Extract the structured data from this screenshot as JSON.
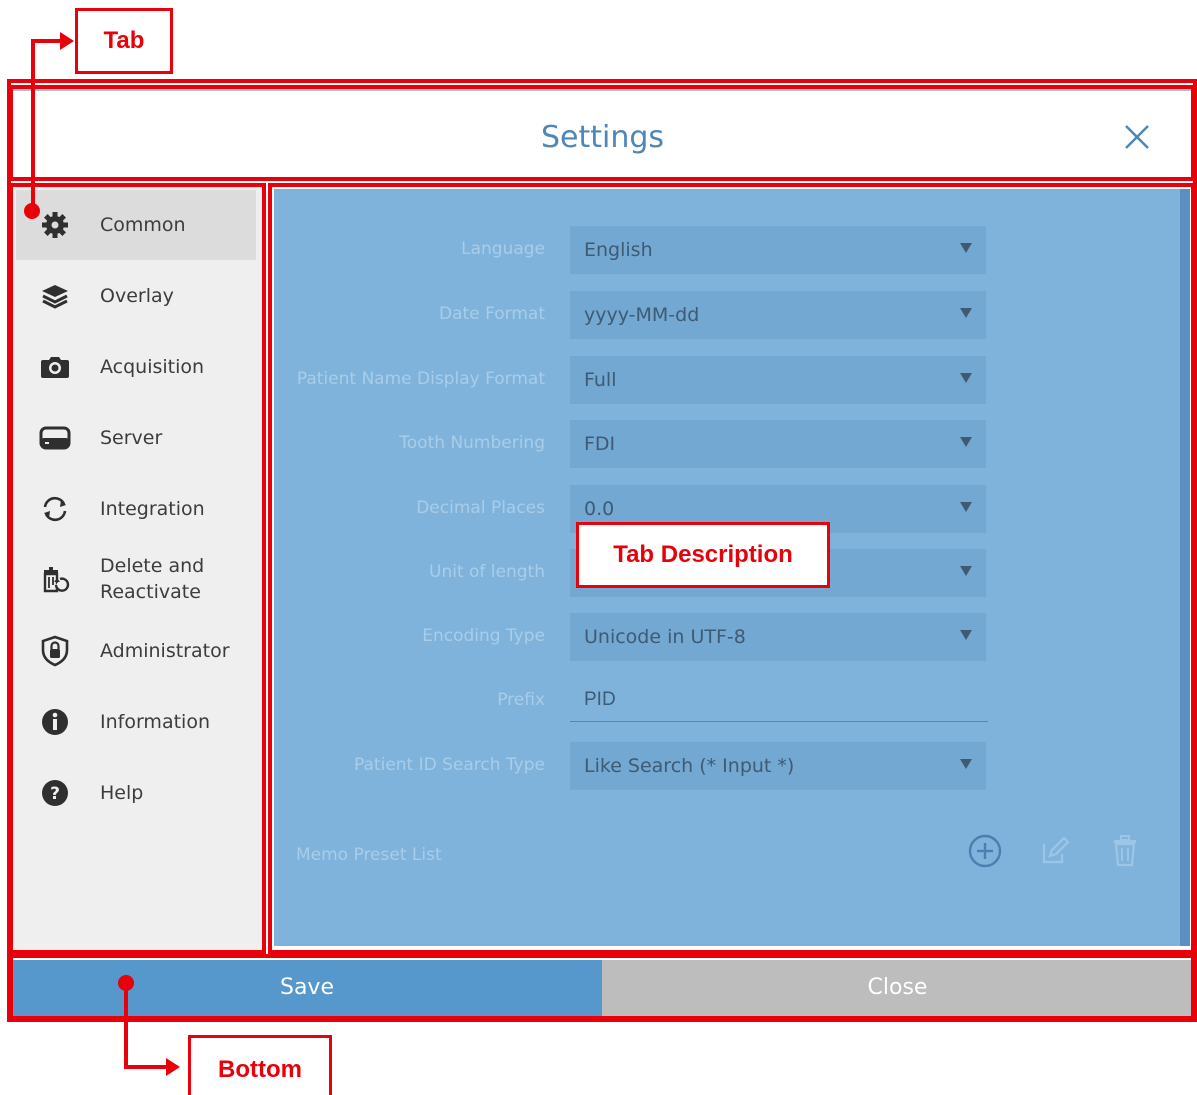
{
  "dialog": {
    "title": "Settings"
  },
  "sidebar": {
    "items": [
      {
        "label": "Common",
        "icon": "gear-icon",
        "active": true
      },
      {
        "label": "Overlay",
        "icon": "layers-icon"
      },
      {
        "label": "Acquisition",
        "icon": "camera-icon"
      },
      {
        "label": "Server",
        "icon": "server-icon"
      },
      {
        "label": "Integration",
        "icon": "sync-icon"
      },
      {
        "label": "Delete and\nReactivate",
        "icon": "trash-restore-icon"
      },
      {
        "label": "Administrator",
        "icon": "shield-lock-icon"
      },
      {
        "label": "Information",
        "icon": "info-icon"
      },
      {
        "label": "Help",
        "icon": "help-icon"
      }
    ]
  },
  "form": {
    "language": {
      "label": "Language",
      "value": "English"
    },
    "date_format": {
      "label": "Date Format",
      "value": "yyyy-MM-dd"
    },
    "patient_name_format": {
      "label": "Patient Name Display Format",
      "value": "Full"
    },
    "tooth_numbering": {
      "label": "Tooth Numbering",
      "value": "FDI"
    },
    "decimal_places": {
      "label": "Decimal Places",
      "value": "0.0"
    },
    "unit_of_length": {
      "label": "Unit of length",
      "value": ""
    },
    "encoding_type": {
      "label": "Encoding Type",
      "value": "Unicode in UTF-8"
    },
    "prefix": {
      "label": "Prefix",
      "value": "PID"
    },
    "patient_id_search": {
      "label": "Patient ID Search Type",
      "value": "Like Search (* Input *)"
    },
    "memo_preset": {
      "label": "Memo Preset List"
    }
  },
  "footer": {
    "save_label": "Save",
    "close_label": "Close"
  },
  "annotations": {
    "tab": "Tab",
    "tab_description": "Tab Description",
    "bottom": "Bottom"
  },
  "colors": {
    "accent": "#5697cc",
    "overlay": "#7fb3dc",
    "annotation_red": "#e8000a"
  }
}
